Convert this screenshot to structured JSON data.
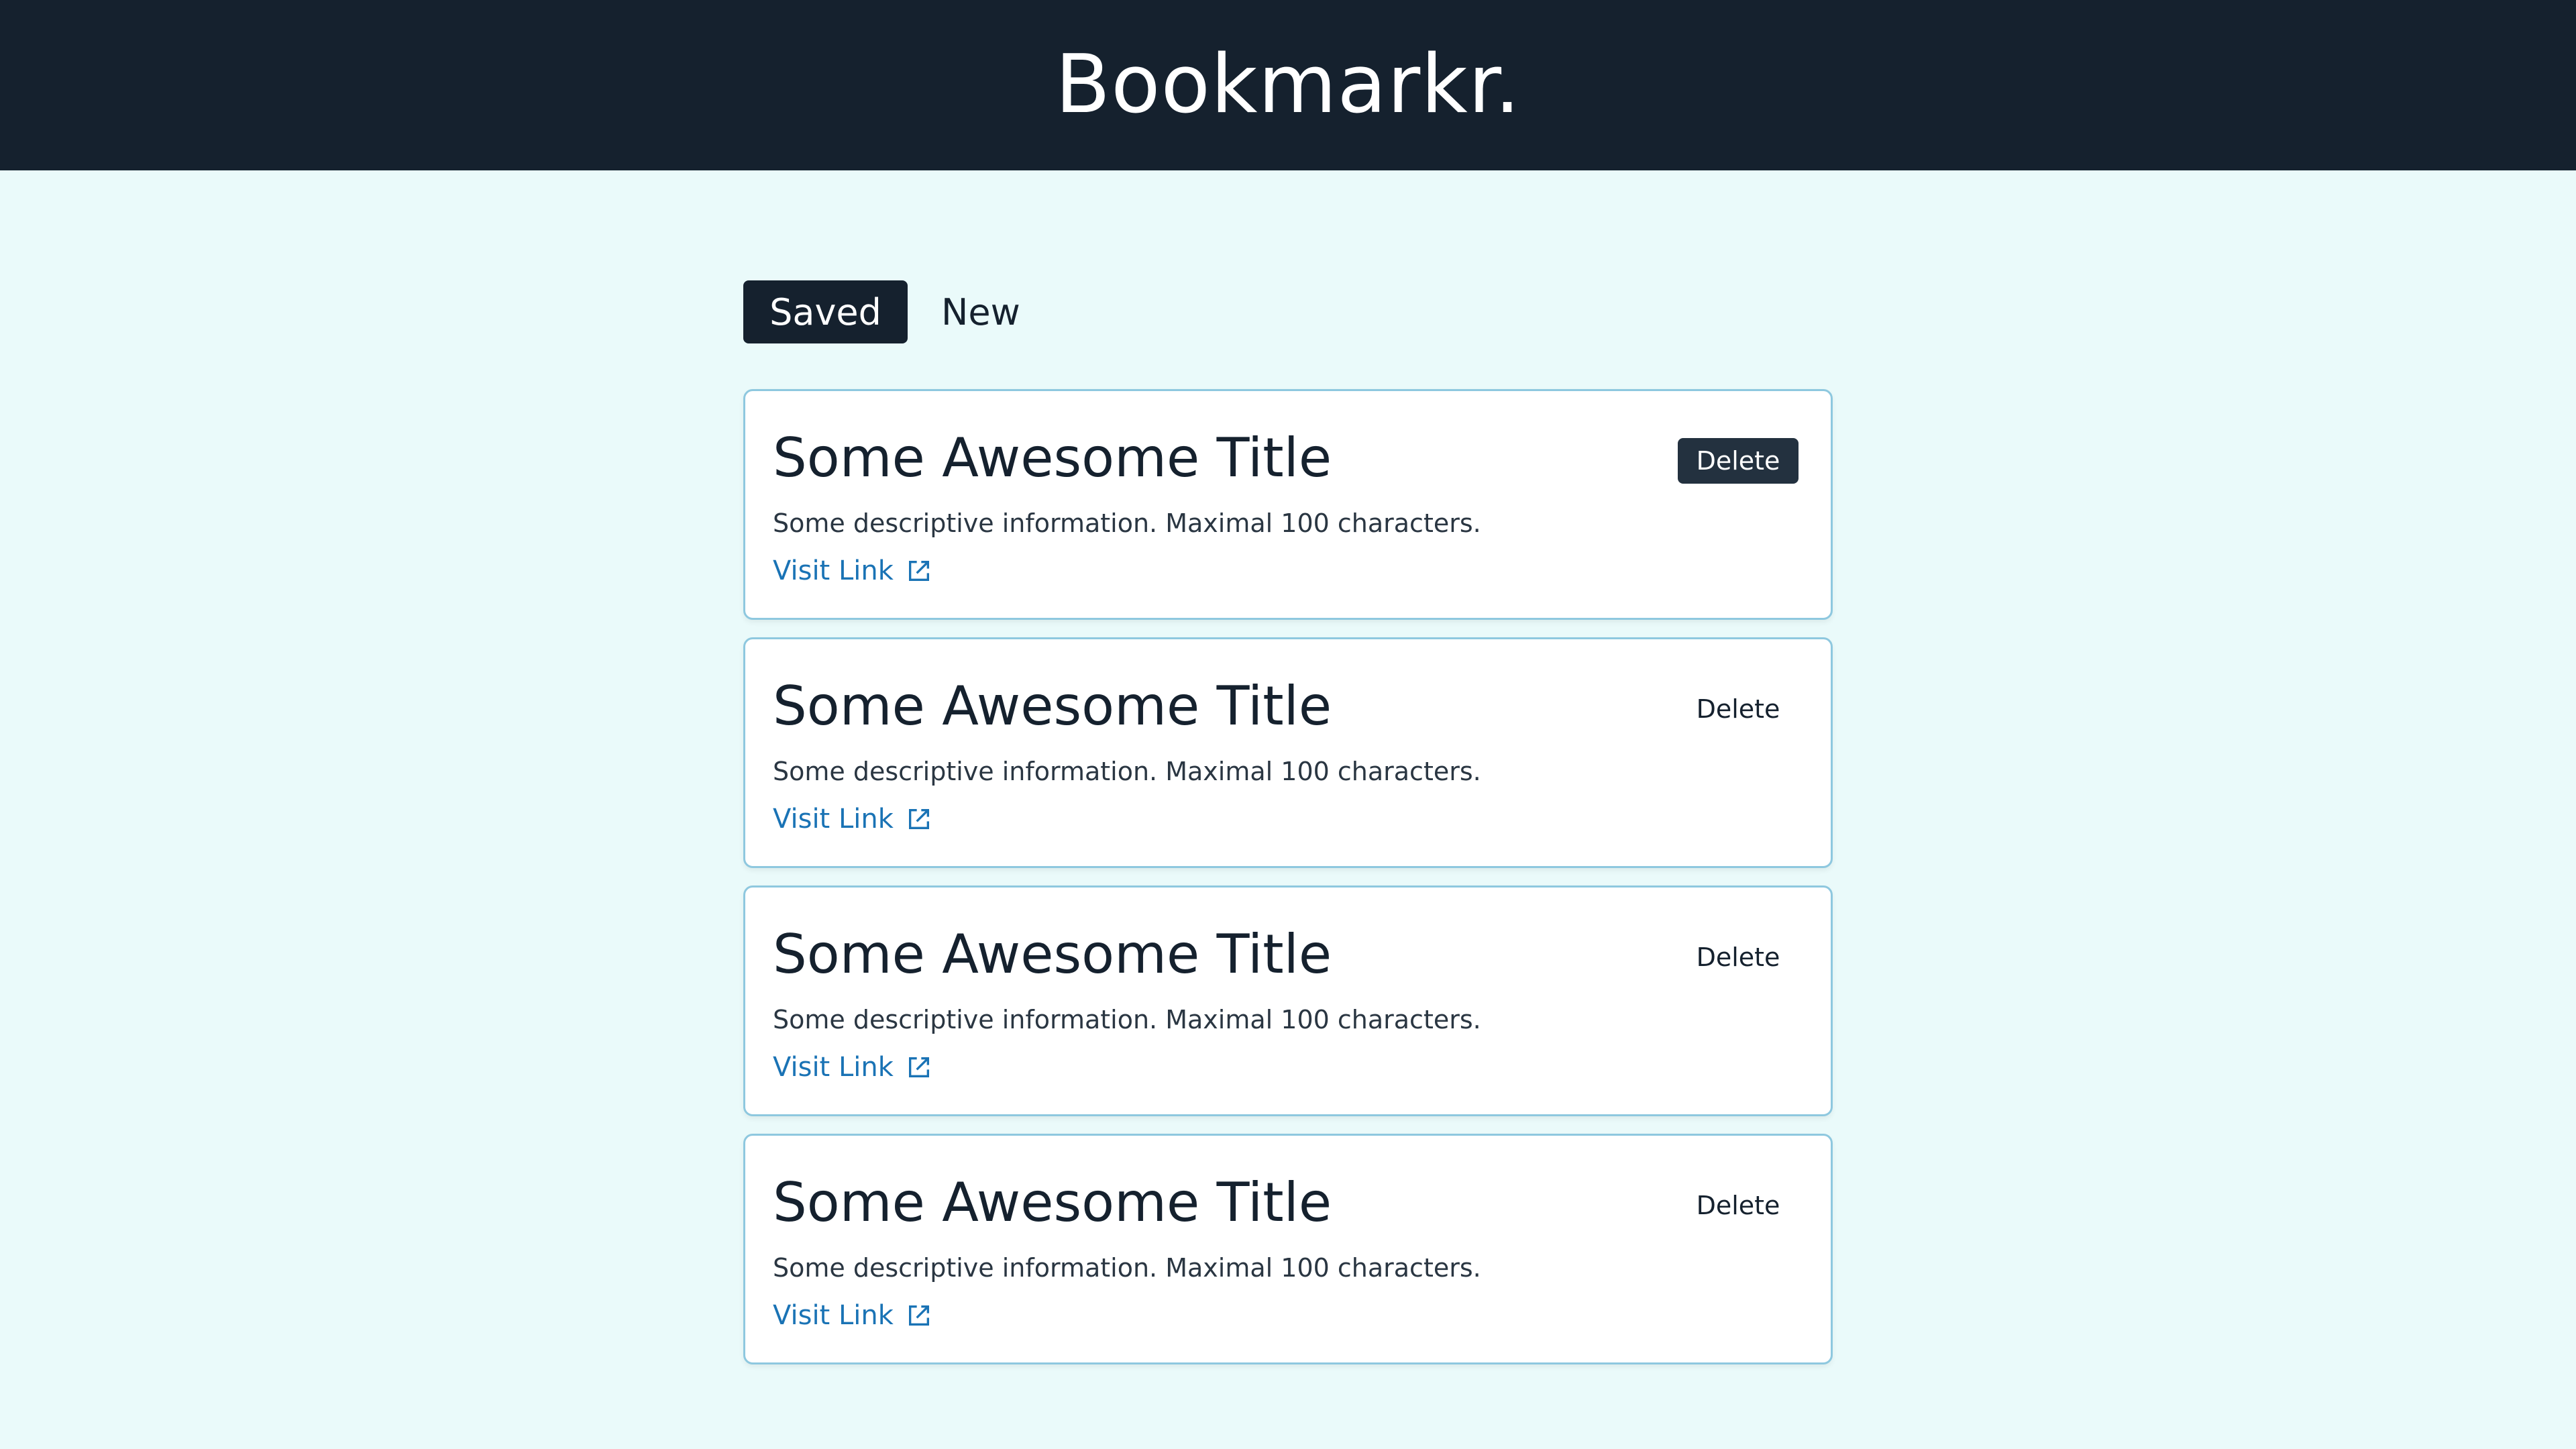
{
  "app": {
    "title": "Bookmarkr."
  },
  "tabs": [
    {
      "label": "Saved",
      "active": true
    },
    {
      "label": "New",
      "active": false
    }
  ],
  "bookmarks": [
    {
      "title": "Some Awesome Title",
      "description": "Some descriptive information. Maximal 100 characters.",
      "link_label": "Visit Link",
      "delete_label": "Delete"
    },
    {
      "title": "Some Awesome Title",
      "description": "Some descriptive information. Maximal 100 characters.",
      "link_label": "Visit Link",
      "delete_label": "Delete"
    },
    {
      "title": "Some Awesome Title",
      "description": "Some descriptive information. Maximal 100 characters.",
      "link_label": "Visit Link",
      "delete_label": "Delete"
    },
    {
      "title": "Some Awesome Title",
      "description": "Some descriptive information. Maximal 100 characters.",
      "link_label": "Visit Link",
      "delete_label": "Delete"
    }
  ],
  "colors": {
    "header_bg": "#15212e",
    "page_bg": "#eafafa",
    "card_border": "#8ec8df",
    "link": "#1a73b5"
  },
  "icons": {
    "external_link": "external-link-icon"
  }
}
